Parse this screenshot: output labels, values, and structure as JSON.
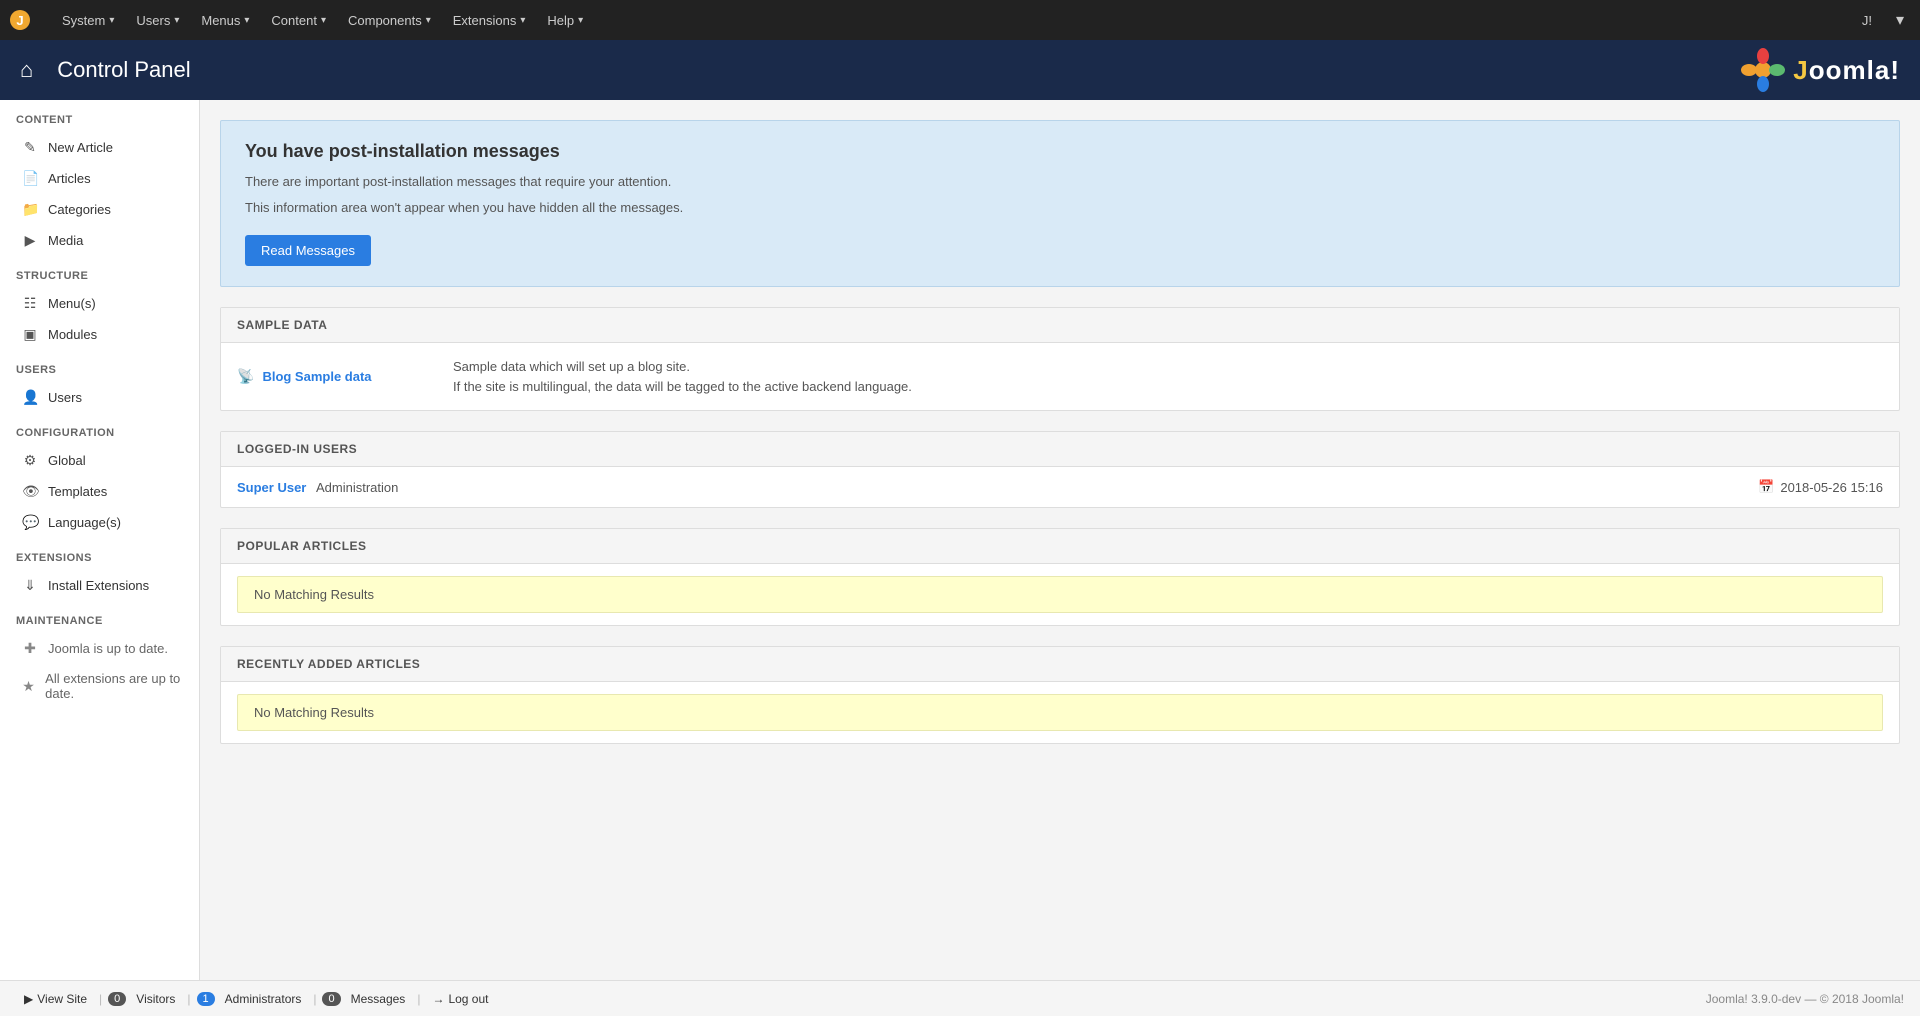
{
  "topnav": {
    "logo_symbol": "✦",
    "items": [
      {
        "label": "System",
        "id": "system"
      },
      {
        "label": "Users",
        "id": "users"
      },
      {
        "label": "Menus",
        "id": "menus"
      },
      {
        "label": "Content",
        "id": "content"
      },
      {
        "label": "Components",
        "id": "components"
      },
      {
        "label": "Extensions",
        "id": "extensions"
      },
      {
        "label": "Help",
        "id": "help"
      }
    ],
    "right_icon_j": "J!",
    "right_icon_user": "👤"
  },
  "header": {
    "home_icon": "⌂",
    "title": "Control Panel",
    "joomla_text": "Joomla!"
  },
  "sidebar": {
    "sections": [
      {
        "title": "CONTENT",
        "items": [
          {
            "label": "New Article",
            "icon": "pencil-icon",
            "id": "new-article"
          },
          {
            "label": "Articles",
            "icon": "file-icon",
            "id": "articles"
          },
          {
            "label": "Categories",
            "icon": "folder-icon",
            "id": "categories"
          },
          {
            "label": "Media",
            "icon": "media-icon",
            "id": "media"
          }
        ]
      },
      {
        "title": "STRUCTURE",
        "items": [
          {
            "label": "Menu(s)",
            "icon": "menu-icon",
            "id": "menus-link"
          },
          {
            "label": "Modules",
            "icon": "module-icon",
            "id": "modules"
          }
        ]
      },
      {
        "title": "USERS",
        "items": [
          {
            "label": "Users",
            "icon": "user-icon",
            "id": "users-link"
          }
        ]
      },
      {
        "title": "CONFIGURATION",
        "items": [
          {
            "label": "Global",
            "icon": "gear-icon",
            "id": "global"
          },
          {
            "label": "Templates",
            "icon": "eye-icon",
            "id": "templates"
          },
          {
            "label": "Language(s)",
            "icon": "chat-icon",
            "id": "languages"
          }
        ]
      },
      {
        "title": "EXTENSIONS",
        "items": [
          {
            "label": "Install Extensions",
            "icon": "install-icon",
            "id": "install-extensions"
          }
        ]
      },
      {
        "title": "MAINTENANCE",
        "maintenance_items": [
          {
            "label": "Joomla is up to date.",
            "icon": "joomla-icon",
            "id": "joomla-update"
          },
          {
            "label": "All extensions are up to date.",
            "icon": "star-icon",
            "id": "ext-update"
          }
        ]
      }
    ]
  },
  "post_install": {
    "title": "You have post-installation messages",
    "line1": "There are important post-installation messages that require your attention.",
    "line2": "This information area won't appear when you have hidden all the messages.",
    "button_label": "Read Messages"
  },
  "sample_data": {
    "section_title": "SAMPLE DATA",
    "rows": [
      {
        "link_label": "Blog Sample data",
        "icon": "wifi-icon",
        "desc_line1": "Sample data which will set up a blog site.",
        "desc_line2": "If the site is multilingual, the data will be tagged to the active backend language."
      }
    ]
  },
  "logged_in_users": {
    "section_title": "LOGGED-IN USERS",
    "rows": [
      {
        "name": "Super User",
        "role": "Administration",
        "datetime": "2018-05-26 15:16",
        "calendar_icon": "calendar-icon"
      }
    ]
  },
  "popular_articles": {
    "section_title": "POPULAR ARTICLES",
    "no_results": "No Matching Results"
  },
  "recently_added": {
    "section_title": "RECENTLY ADDED ARTICLES",
    "no_results": "No Matching Results"
  },
  "bottombar": {
    "view_site_label": "View Site",
    "visitors_badge": "0",
    "visitors_label": "Visitors",
    "admins_badge": "1",
    "admins_label": "Administrators",
    "messages_badge": "0",
    "messages_label": "Messages",
    "logout_icon": "logout-icon",
    "logout_label": "Log out",
    "version_text": "Joomla! 3.9.0-dev — © 2018 Joomla!"
  }
}
